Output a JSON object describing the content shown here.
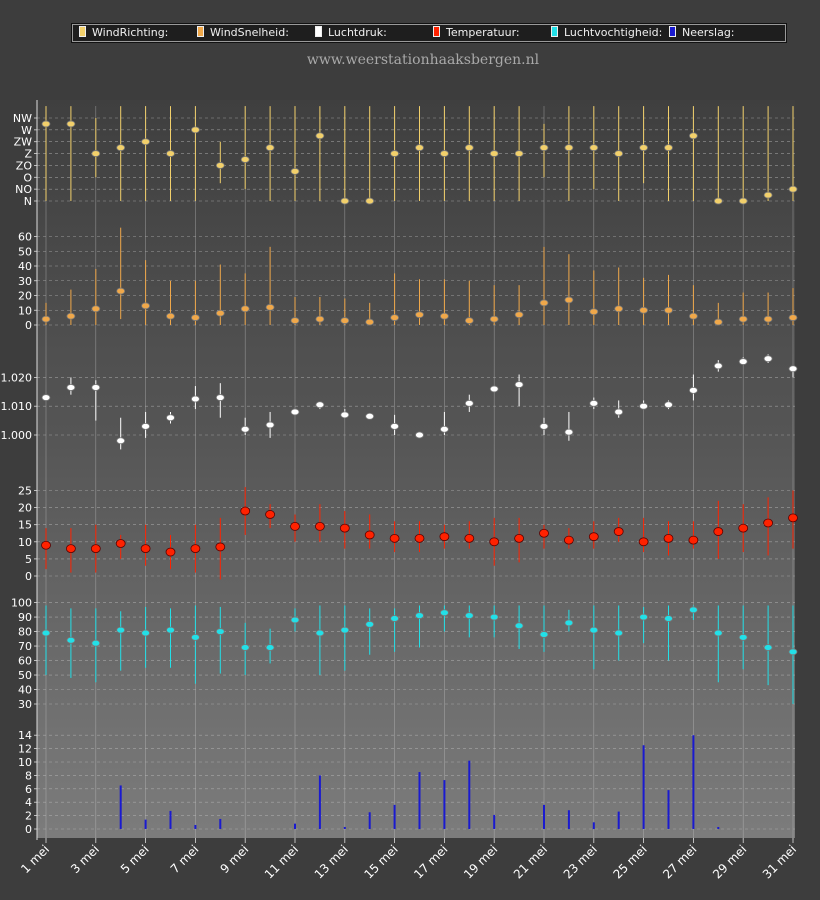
{
  "site_title": "www.weerstationhaaksbergen.nl",
  "legend": [
    {
      "label": "WindRichting:",
      "color": "#f2d06b"
    },
    {
      "label": "WindSnelheid:",
      "color": "#f0a84a"
    },
    {
      "label": "Luchtdruk:",
      "color": "#ffffff"
    },
    {
      "label": "Temperatuur:",
      "color": "#ff2200"
    },
    {
      "label": "Luchtvochtigheid:",
      "color": "#22e0e8"
    },
    {
      "label": "Neerslag:",
      "color": "#1a1ad0"
    }
  ],
  "chart_data": {
    "type": "multi-panel-range",
    "x_labels": [
      "1 mei",
      "3 mei",
      "5 mei",
      "7 mei",
      "9 mei",
      "11 mei",
      "13 mei",
      "15 mei",
      "17 mei",
      "19 mei",
      "21 mei",
      "23 mei",
      "25 mei",
      "27 mei",
      "29 mei",
      "31 mei"
    ],
    "days": 31,
    "panels": [
      {
        "name": "WindRichting",
        "type": "range-dot",
        "color": "#f2d06b",
        "range": [
          0,
          7
        ],
        "tick_labels": [
          "N",
          "NO",
          "O",
          "ZO",
          "Z",
          "ZW",
          "W",
          "NW"
        ],
        "ticks": [
          0,
          1,
          2,
          3,
          4,
          5,
          6,
          7
        ],
        "values": [
          6.5,
          6.5,
          4.0,
          4.5,
          5.0,
          4.0,
          6.0,
          3.0,
          3.5,
          4.5,
          2.5,
          5.5,
          0,
          0,
          4.0,
          4.5,
          4.0,
          4.5,
          4.0,
          4.0,
          4.5,
          4.5,
          4.5,
          4.0,
          4.5,
          4.5,
          5.5,
          0,
          0,
          0.5,
          1.0
        ],
        "lows": [
          0,
          0,
          2,
          0,
          0,
          0,
          0,
          1.5,
          1,
          0,
          0,
          0,
          0,
          0,
          0,
          0,
          0,
          0,
          0,
          0,
          2,
          0,
          1,
          0,
          1.5,
          0,
          0,
          0,
          0,
          0,
          0
        ],
        "highs": [
          8,
          8,
          7,
          8,
          8,
          8,
          8,
          5,
          8,
          8,
          8,
          8,
          8,
          8,
          8,
          8,
          8,
          8,
          8,
          8,
          6.5,
          8,
          8,
          8,
          8,
          8,
          8,
          8,
          8,
          8,
          8
        ]
      },
      {
        "name": "WindSnelheid",
        "type": "range-dot",
        "color": "#f0a84a",
        "range": [
          0,
          68
        ],
        "ticks": [
          0,
          10,
          20,
          30,
          40,
          50,
          60
        ],
        "values": [
          4,
          6,
          11,
          23,
          13,
          6,
          5,
          8,
          11,
          12,
          3,
          4,
          3,
          2,
          5,
          7,
          6,
          3,
          4,
          7,
          15,
          17,
          9,
          11,
          10,
          10,
          6,
          2,
          4,
          4,
          5
        ],
        "lows": [
          0,
          0,
          0,
          4,
          0,
          0,
          0,
          0,
          0,
          0,
          0,
          0,
          0,
          0,
          0,
          0,
          0,
          0,
          0,
          0,
          0,
          0,
          0,
          0,
          0,
          0,
          0,
          0,
          0,
          0,
          0
        ],
        "highs": [
          15,
          24,
          38,
          66,
          44,
          30,
          30,
          41,
          35,
          53,
          19,
          19,
          18,
          15,
          35,
          31,
          31,
          30,
          27,
          27,
          53,
          48,
          37,
          39,
          32,
          34,
          27,
          15,
          22,
          22,
          25
        ]
      },
      {
        "name": "Luchtdruk",
        "type": "range-dot",
        "color": "#ffffff",
        "range": [
          993,
          1030
        ],
        "tick_labels": [
          "1.000",
          "1.010",
          "1.020"
        ],
        "ticks": [
          1000,
          1010,
          1020
        ],
        "values": [
          1013,
          1016.5,
          1016.5,
          998,
          1003,
          1006,
          1012.5,
          1013,
          1002,
          1003.5,
          1008,
          1010.5,
          1007,
          1006.5,
          1003,
          1000,
          1002,
          1011,
          1016,
          1017.5,
          1003,
          1001,
          1011,
          1008,
          1010,
          1010.5,
          1015.5,
          1024,
          1025.5,
          1026.5,
          1023
        ],
        "lows": [
          1013,
          1014,
          1005,
          995,
          999,
          1004,
          1009,
          1006,
          1000,
          999,
          1007,
          1009,
          1006,
          1006,
          1000,
          999,
          1000,
          1008,
          1015,
          1010,
          1000,
          998,
          1009,
          1006,
          1009,
          1009,
          1012,
          1022,
          1025,
          1025,
          1020
        ],
        "highs": [
          1014,
          1020,
          1019,
          1006,
          1008,
          1008,
          1017,
          1018,
          1006,
          1008,
          1009,
          1011,
          1009,
          1007,
          1007,
          1001,
          1008,
          1014,
          1017,
          1021,
          1006,
          1008,
          1013,
          1012,
          1012,
          1012,
          1021,
          1026,
          1027,
          1028,
          1024
        ]
      },
      {
        "name": "Temperatuur",
        "type": "range-dot",
        "color": "#ff2200",
        "range": [
          -3,
          28
        ],
        "ticks": [
          0,
          5,
          10,
          15,
          20,
          25
        ],
        "values": [
          9,
          8,
          8,
          9.5,
          8,
          7,
          8,
          8.5,
          19,
          18,
          14.5,
          14.5,
          14,
          12,
          11,
          11,
          11.5,
          11,
          10,
          11,
          12.5,
          10.5,
          11.5,
          13,
          10,
          11,
          10.5,
          13,
          14,
          15.5,
          17
        ],
        "lows": [
          2,
          1,
          1,
          5,
          3,
          2,
          1,
          -1,
          12,
          14,
          10,
          10,
          8,
          8,
          7,
          7,
          8,
          8,
          3,
          4,
          8,
          8,
          8,
          10,
          7,
          6,
          8,
          5,
          7,
          6,
          8
        ],
        "highs": [
          14,
          14,
          15,
          12,
          15,
          12,
          15,
          17,
          26,
          21,
          18,
          21,
          19,
          18,
          16,
          16,
          15,
          16,
          17,
          17,
          15,
          14,
          16,
          17,
          17,
          16,
          16,
          22,
          21,
          23,
          25
        ]
      },
      {
        "name": "Luchtvochtigheid",
        "type": "range-dot",
        "color": "#22e0e8",
        "range": [
          25,
          100
        ],
        "ticks": [
          30,
          40,
          50,
          60,
          70,
          80,
          90,
          100
        ],
        "values": [
          79,
          74,
          72,
          81,
          79,
          81,
          76,
          80,
          69,
          69,
          88,
          79,
          81,
          85,
          89,
          91,
          93,
          91,
          90,
          84,
          78,
          86,
          81,
          79,
          90,
          89,
          95,
          79,
          76,
          69,
          66
        ],
        "lows": [
          50,
          48,
          45,
          53,
          55,
          55,
          44,
          51,
          50,
          58,
          80,
          50,
          53,
          64,
          66,
          69,
          80,
          76,
          76,
          68,
          66,
          80,
          54,
          60,
          72,
          60,
          88,
          45,
          54,
          43,
          30
        ],
        "highs": [
          98,
          96,
          96,
          94,
          97,
          96,
          98,
          97,
          86,
          82,
          96,
          98,
          98,
          96,
          96,
          98,
          98,
          98,
          98,
          98,
          98,
          95,
          98,
          98,
          97,
          98,
          98,
          98,
          98,
          98,
          98
        ]
      },
      {
        "name": "Neerslag",
        "type": "bar",
        "color": "#1a1ad0",
        "range": [
          -0.8,
          15
        ],
        "ticks": [
          0,
          2,
          4,
          6,
          8,
          10,
          12,
          14
        ],
        "values": [
          0,
          0,
          0,
          6.5,
          1.4,
          2.7,
          0.6,
          1.5,
          0,
          0,
          0.8,
          8.0,
          0.3,
          2.5,
          3.6,
          8.5,
          7.3,
          10.2,
          2.1,
          0,
          3.6,
          2.8,
          1.0,
          2.6,
          12.5,
          5.8,
          14.0,
          0.3,
          0,
          0,
          0
        ]
      }
    ]
  }
}
